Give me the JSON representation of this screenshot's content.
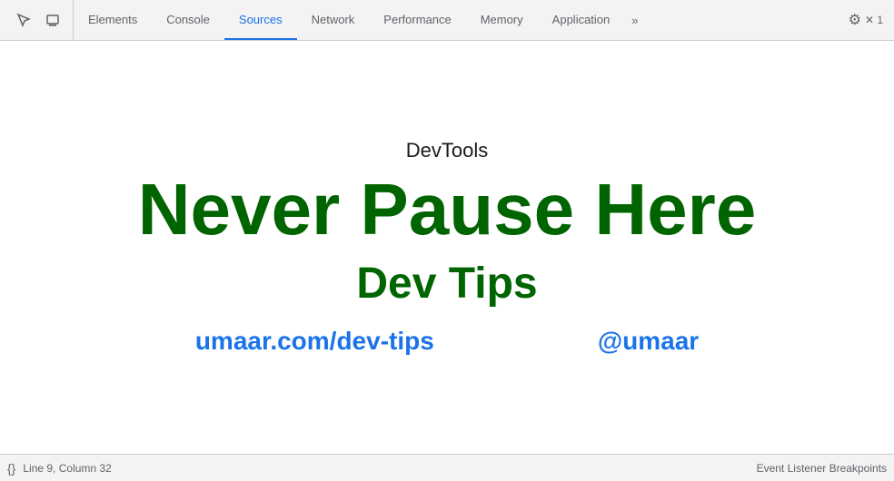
{
  "toolbar": {
    "inspect_icon": "⬚",
    "device_icon": "⬜",
    "tabs": [
      {
        "label": "Elements",
        "active": false
      },
      {
        "label": "Console",
        "active": false
      },
      {
        "label": "Sources",
        "active": true
      },
      {
        "label": "Network",
        "active": false
      },
      {
        "label": "Performance",
        "active": false
      },
      {
        "label": "Memory",
        "active": false
      },
      {
        "label": "Application",
        "active": false
      }
    ],
    "more_tabs": "»",
    "close_label": "✕"
  },
  "hero": {
    "subtitle": "DevTools",
    "main_title": "Never Pause Here",
    "section_title": "Dev Tips",
    "link_left": "umaar.com/dev-tips",
    "link_right": "@umaar"
  },
  "statusbar": {
    "icon": "{}",
    "position": "Line 9, Column 32",
    "breakpoints": "Event Listener Breakpoints"
  }
}
